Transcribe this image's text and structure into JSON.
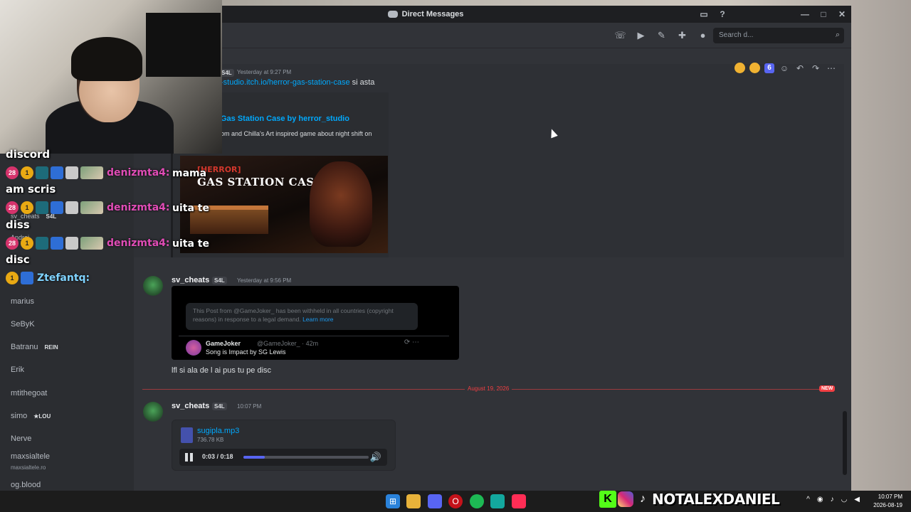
{
  "window": {
    "title": "Direct Messages",
    "controls": [
      "—",
      "□",
      "✕"
    ]
  },
  "toolbar": {
    "search_placeholder": "Search d...",
    "icons": [
      "phone-icon",
      "video-icon",
      "pin-icon",
      "add-member-icon",
      "profile-icon",
      "inbox-icon",
      "help-icon"
    ]
  },
  "sidebar": {
    "items": [
      {
        "label": "marius"
      },
      {
        "label": "SeByK"
      },
      {
        "label": "Batranu",
        "badge": "REIN"
      },
      {
        "label": "Erik"
      },
      {
        "label": "mtithegoat"
      },
      {
        "label": "simo",
        "badge": "★LOU"
      },
      {
        "label": "Nerve"
      },
      {
        "label": "maxsialtele",
        "sub": "maxsialtele.ro"
      },
      {
        "label": "og.blood"
      }
    ],
    "partial": [
      {
        "label": "sv_cheats",
        "badge": "S4L"
      },
      {
        "label": "Andrei"
      }
    ]
  },
  "messages": {
    "msg1": {
      "tag": "S4L",
      "time": "Yesterday at 9:27 PM",
      "link": "-studio.itch.io/herror-gas-station-case",
      "text_after": " si asta",
      "embed_title": "Gas Station Case by herror_studio",
      "embed_desc": "om and Chilla's Art inspired game about night shift on",
      "thumb_tag": "[HERROR]",
      "thumb_title": "GAS STATION CASE"
    },
    "msg2": {
      "user": "sv_cheats",
      "tag": "S4L",
      "time": "Yesterday at 9:56 PM",
      "tweet_notice": "This Post from @GameJoker_ has been withheld in all countries (copyright reasons) in response to a legal demand.",
      "tweet_learn_more": "Learn more",
      "tweet_name": "GameJoker",
      "tweet_handle": "@GameJoker_ · 42m",
      "tweet_body": "Song is Impact by SG Lewis",
      "text": "lfl si ala de l ai pus tu pe disc"
    },
    "divider": {
      "date": "August 19, 2026",
      "new_label": "NEW"
    },
    "msg3": {
      "user": "sv_cheats",
      "tag": "S4L",
      "time": "10:07 PM",
      "file_name": "sugipla.mp3",
      "file_size": "736.78 KB",
      "player_time": "0:03 / 0:18",
      "progress": 0.17
    }
  },
  "reactions": {
    "count_badge": "6"
  },
  "overlay_chat": [
    {
      "kind": "msg",
      "text": "discord"
    },
    {
      "kind": "user",
      "name": "denizmta4:",
      "badge_num": "28",
      "msg": "mama"
    },
    {
      "kind": "msg",
      "text": "am scris"
    },
    {
      "kind": "user",
      "name": "denizmta4:",
      "badge_num": "28",
      "msg": "uita te"
    },
    {
      "kind": "msg",
      "text": "diss"
    },
    {
      "kind": "user",
      "name": "denizmta4:",
      "badge_num": "28",
      "msg": "uita te"
    },
    {
      "kind": "msg",
      "text": "disc"
    },
    {
      "kind": "user",
      "name": "Ztefantq:",
      "badge_num": "1"
    }
  ],
  "taskbar": {
    "time": "10:07 PM",
    "date": "2026-08-19"
  },
  "streamer": {
    "handle": "NOTALEXDANIEL",
    "k_logo": "K"
  },
  "colors": {
    "accent": "#5865f2",
    "link": "#00a8fc",
    "new": "#f23f43",
    "kick": "#53fc18"
  }
}
